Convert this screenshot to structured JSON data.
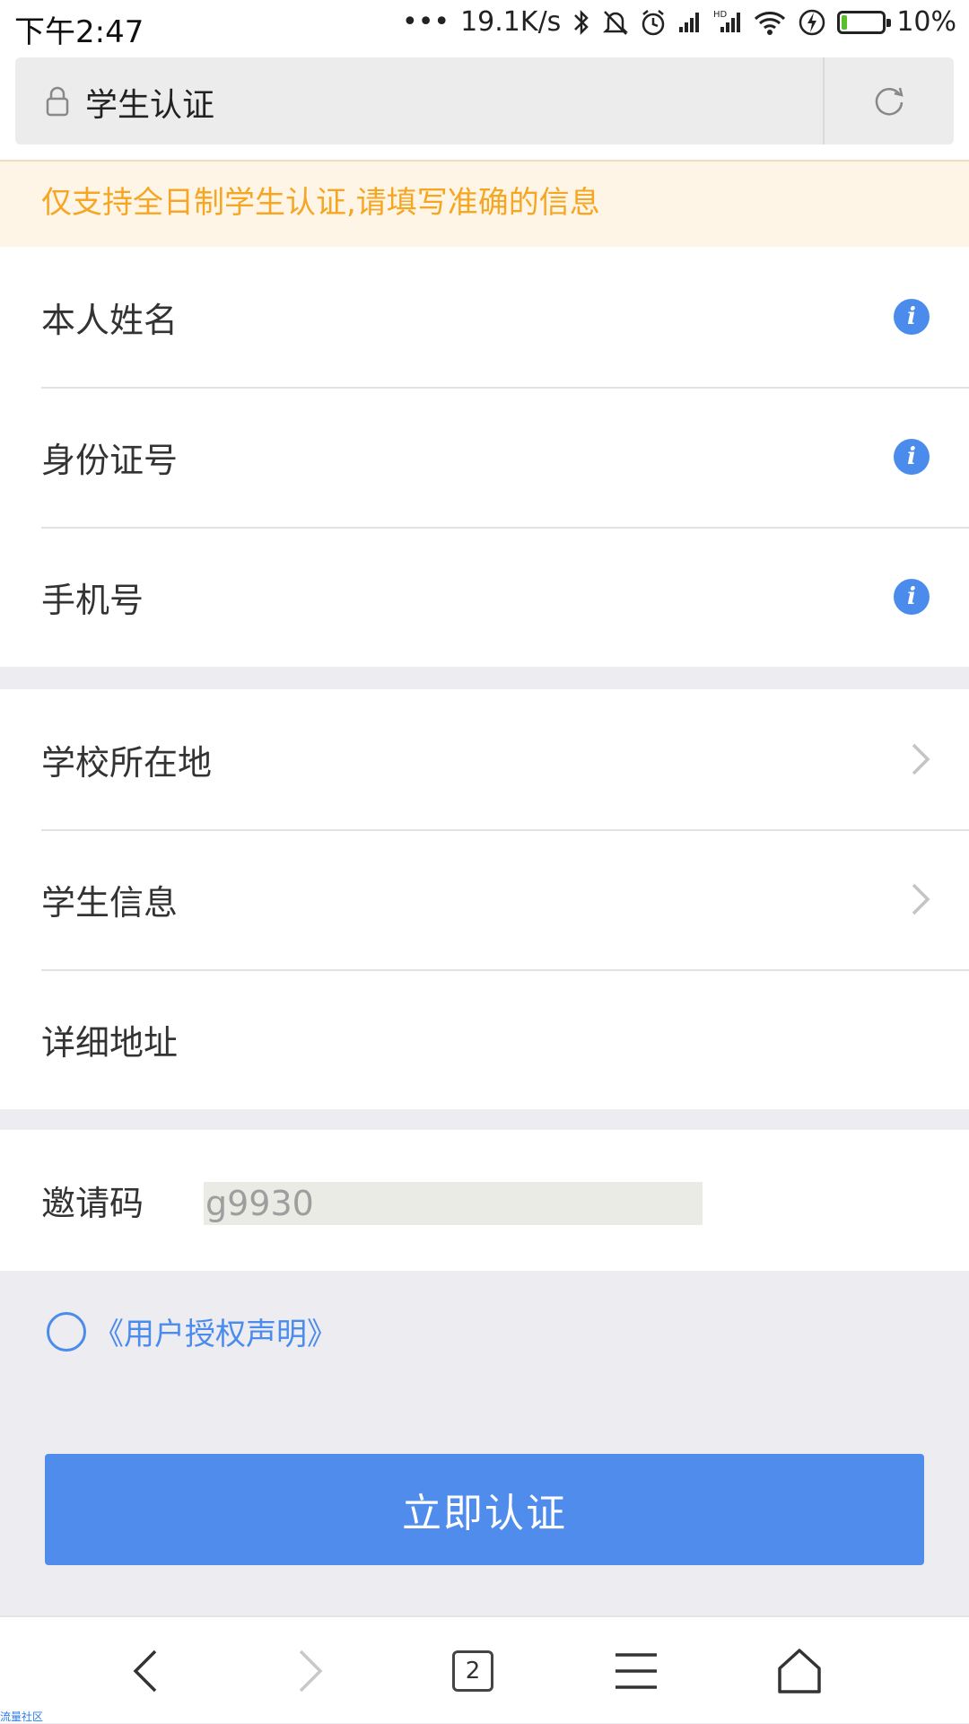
{
  "status_bar": {
    "time": "下午2:47",
    "dots": "•••",
    "net_speed": "19.1K/s",
    "battery_percent": "10%",
    "battery_level": 0.1,
    "colors": {
      "battery_fill": "#5bbf2a"
    }
  },
  "url_bar": {
    "title": "学生认证"
  },
  "notice": {
    "text": "仅支持全日制学生认证,请填写准确的信息"
  },
  "personal_fields": [
    {
      "label": "本人姓名"
    },
    {
      "label": "身份证号"
    },
    {
      "label": "手机号"
    }
  ],
  "school_fields": [
    {
      "label": "学校所在地"
    },
    {
      "label": "学生信息"
    },
    {
      "label": "详细地址"
    }
  ],
  "invite": {
    "label": "邀请码",
    "value": "g9930"
  },
  "agreement": {
    "link_text": "《用户授权声明》"
  },
  "submit_label": "立即认证",
  "bottom_nav": {
    "tab_count": "2"
  },
  "watermark": "流量社区",
  "colors": {
    "accent": "#4f8cec",
    "notice_text": "#f5a623",
    "notice_bg": "#fff5e6"
  }
}
